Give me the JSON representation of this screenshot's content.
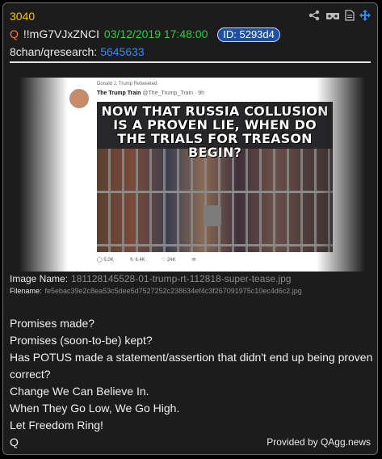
{
  "post": {
    "number": "3040",
    "q_label": "Q",
    "tripcode": "!!mG7VJxZNCI",
    "datetime": "03/12/2019 17:48:00",
    "id_label": "ID: 5293d4",
    "board": "8chan/qresearch:",
    "thread_link": "5645633"
  },
  "image": {
    "tweet": {
      "retweeted_by": "Donald J. Trump Retweeted",
      "account_name": "The Trump Train",
      "handle": "@The_Trump_Train · 9h",
      "meme_text": "NOW THAT RUSSIA COLLUSION IS A PROVEN LIE, WHEN DO THE TRIALS FOR TREASON BEGIN?",
      "replies": "5.0K",
      "retweets": "6.4K",
      "likes": "24K"
    },
    "name_label": "Image Name:",
    "name_value": "181128145528-01-trump-rt-112818-super-tease.jpg",
    "filename_label": "Filename:",
    "filename_value": "fe5ebac39e2c8ea53c5dee5d7527252c238634ef4c3f267091975c10ec4d6c2.jpg"
  },
  "body_lines": [
    "Promises made?",
    "Promises (soon-to-be) kept?",
    "Has POTUS made a statement/assertion that didn't end up being proven correct?",
    "Change We Can Believe In.",
    "When They Go Low, We Go High.",
    "Let Freedom Ring!",
    "Q"
  ],
  "footer": "Provided by QAgg.news",
  "icons": [
    "share-icon",
    "vr-icon",
    "document-icon",
    "move-icon"
  ],
  "colors": {
    "number": "#f2c200",
    "q": "#ff7a32",
    "date": "#26d13c",
    "link": "#2f8bff",
    "id_pill": "#1e4fa0"
  }
}
